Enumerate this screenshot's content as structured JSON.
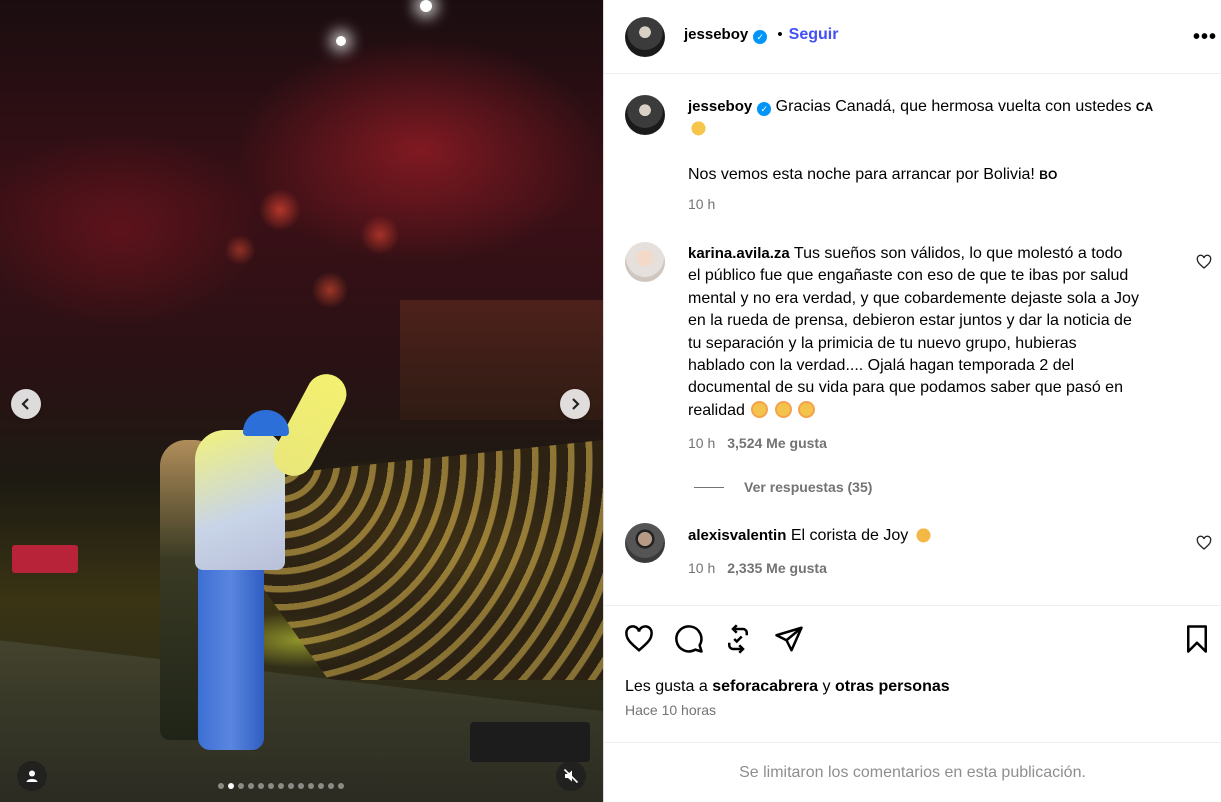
{
  "post": {
    "author": "jesseboy",
    "follow_label": "Seguir",
    "more_label": "•••"
  },
  "caption": {
    "username": "jesseboy",
    "line1": "Gracias Canadá, que hermosa vuelta con ustedes",
    "flag1": "CA",
    "line2": "Nos vemos esta noche para arrancar por Bolivia!",
    "flag2": "BO",
    "time": "10 h"
  },
  "comments": [
    {
      "username": "karina.avila.za",
      "text_lines": [
        "Tus sueños son válidos, lo que molestó a todo",
        "el público fue que engañaste con eso de que te ibas por salud",
        "mental y no era verdad, y que cobardemente dejaste sola a Joy",
        "en la rueda de prensa, debieron estar juntos y dar la noticia de",
        "tu separación y la primicia de tu nuevo grupo, hubieras",
        "hablado con la verdad.... Ojalá hagan temporada 2 del",
        "documental de su vida para que podamos saber que pasó en",
        "realidad"
      ],
      "time": "10 h",
      "likes": "3,524 Me gusta",
      "replies_label": "Ver respuestas (35)"
    },
    {
      "username": "alexisvalentin",
      "text": "El corista de Joy",
      "time": "10 h",
      "likes": "2,335 Me gusta"
    }
  ],
  "likes": {
    "prefix": "Les gusta a",
    "user": "seforacabrera",
    "joiner": "y",
    "others": "otras personas"
  },
  "post_time": "Hace 10 horas",
  "footer_text": "Se limitaron los comentarios en esta publicación.",
  "carousel": {
    "slide_count": 13,
    "active_index": 1
  },
  "icons": {
    "prev": "chevron-left-icon",
    "next": "chevron-right-icon",
    "like": "heart-icon",
    "comment": "comment-icon",
    "repost": "repost-icon",
    "share": "share-icon",
    "save": "bookmark-icon",
    "tag": "user-tag-icon",
    "mute": "muted-speaker-icon"
  },
  "colors": {
    "follow": "#4150f7",
    "verified": "#0095f6",
    "secondary_text": "#737373"
  }
}
